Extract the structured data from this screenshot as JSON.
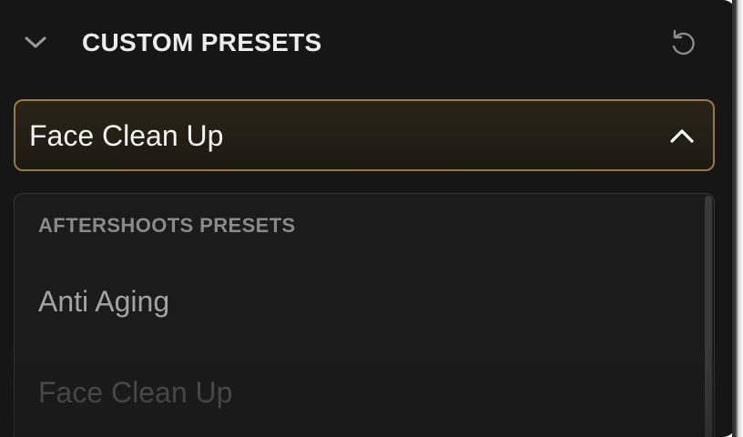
{
  "header": {
    "collapse_icon": "chevron-down-icon",
    "title": "CUSTOM PRESETS",
    "reset_icon": "reset-icon"
  },
  "select": {
    "value": "Face Clean Up",
    "caret_icon": "chevron-up-icon",
    "expanded": true
  },
  "dropdown": {
    "group_label": "AFTERSHOOTS PRESETS",
    "options": [
      {
        "label": "Anti Aging"
      },
      {
        "label": "Face Clean Up"
      }
    ]
  },
  "colors": {
    "panel_bg": "#161616",
    "accent_border": "#9a7a3c",
    "text_primary": "#f3f3f3",
    "text_muted": "#a3a3a3",
    "text_faded": "#515151"
  }
}
